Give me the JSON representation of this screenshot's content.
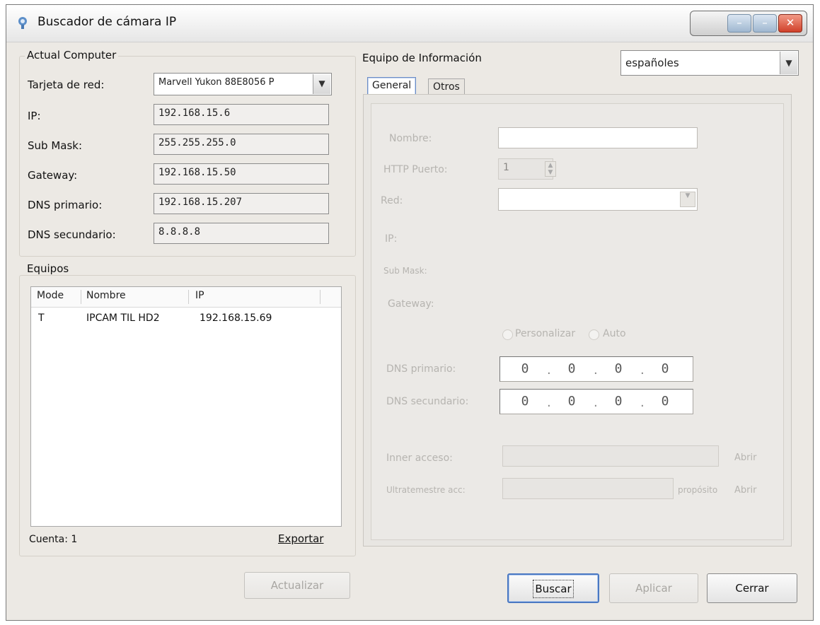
{
  "window": {
    "title": "Buscador de cámara IP",
    "min_label": "–",
    "close_label": "✕"
  },
  "computer": {
    "group_label": "Actual Computer",
    "fields": [
      {
        "label": "Tarjeta de red:",
        "value": "Marvell Yukon 88E8056 P"
      },
      {
        "label": "IP:",
        "value": "192.168.15.6"
      },
      {
        "label": "Sub Mask:",
        "value": "255.255.255.0"
      },
      {
        "label": "Gateway:",
        "value": "192.168.15.50"
      },
      {
        "label": "DNS primario:",
        "value": "192.168.15.207"
      },
      {
        "label": "DNS secundario:",
        "value": "8.8.8.8"
      }
    ]
  },
  "devices": {
    "group_label": "Equipos",
    "columns": [
      "Mode",
      "Nombre",
      "IP"
    ],
    "rows": [
      {
        "mode": "T",
        "name": "IPCAM TIL HD2",
        "ip": "192.168.15.69"
      }
    ],
    "count_label": "Cuenta: 1",
    "export_label": "Exportar"
  },
  "info": {
    "group_label": "Equipo de Información",
    "language": "españoles",
    "tabs": [
      "General",
      "Otros"
    ],
    "labels": {
      "name": "Nombre:",
      "http_port": "HTTP Puerto:",
      "network": "Red:",
      "ip": "IP:",
      "submask": "Sub Mask:",
      "gateway": "Gateway:",
      "personalize": "Personalizar",
      "auto": "Auto",
      "dns1": "DNS primario:",
      "dns2": "DNS secundario:",
      "inner_access": "Inner acceso:",
      "outer_access": "Ultratemestre acc:",
      "open": "Abrir",
      "prop": "propósito"
    },
    "http_port_value": "1",
    "dns1": [
      "0",
      "0",
      "0",
      "0"
    ],
    "dns2": [
      "0",
      "0",
      "0",
      "0"
    ]
  },
  "buttons": {
    "update": "Actualizar",
    "search": "Buscar",
    "apply": "Aplicar",
    "close": "Cerrar"
  }
}
